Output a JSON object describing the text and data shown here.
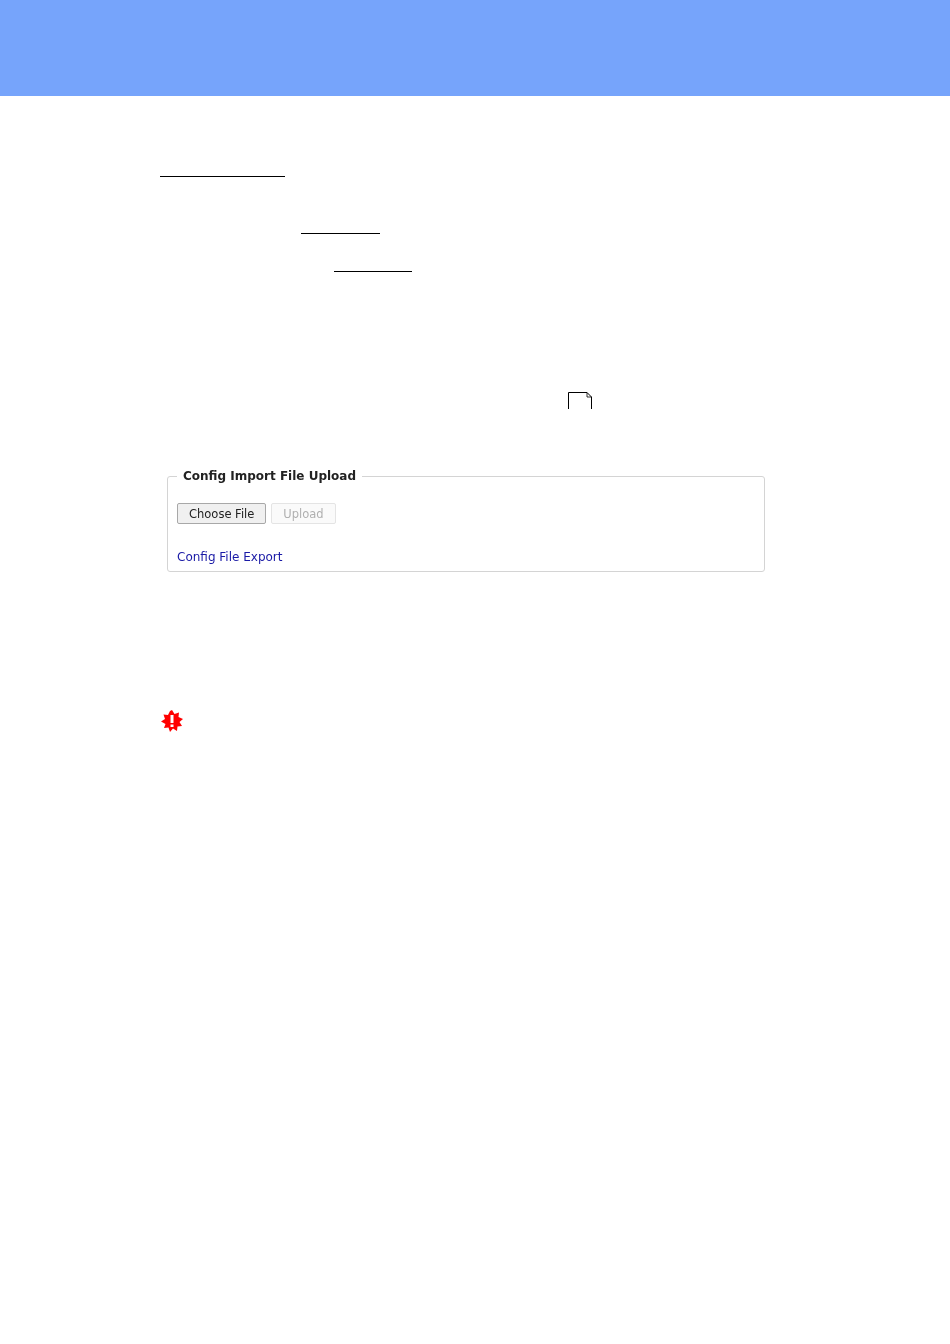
{
  "config_upload": {
    "legend": "Config Import File Upload",
    "buttons": [
      {
        "label": "Choose File",
        "disabled": false
      },
      {
        "label": "Upload",
        "disabled": true
      }
    ],
    "export_link": "Config File Export"
  }
}
